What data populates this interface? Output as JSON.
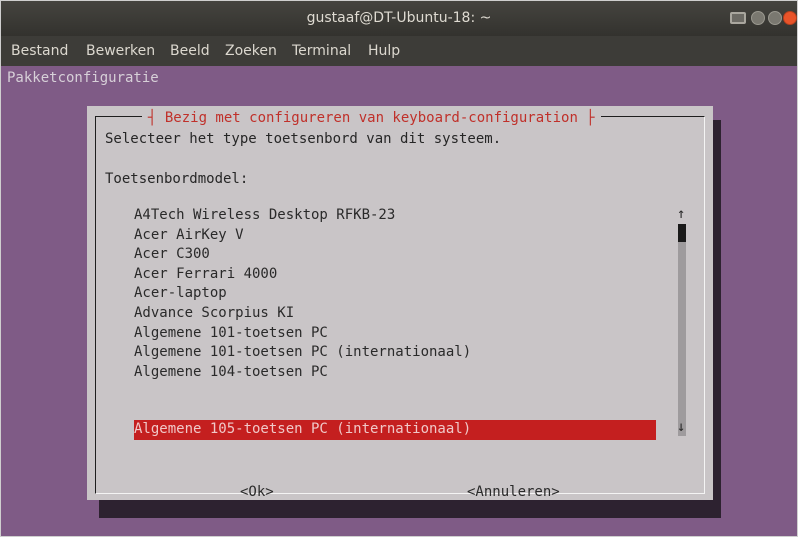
{
  "window": {
    "title": "gustaaf@DT-Ubuntu-18: ~"
  },
  "menubar": {
    "items": [
      {
        "label": "Bestand",
        "name": "menu-bestand"
      },
      {
        "label": "Bewerken",
        "name": "menu-bewerken"
      },
      {
        "label": "Beeld",
        "name": "menu-beeld"
      },
      {
        "label": "Zoeken",
        "name": "menu-zoeken"
      },
      {
        "label": "Terminal",
        "name": "menu-terminal"
      },
      {
        "label": "Hulp",
        "name": "menu-hulp"
      }
    ]
  },
  "terminal": {
    "backtitle": "Pakketconfiguratie"
  },
  "dialog": {
    "title": "Bezig met configureren van keyboard-configuration",
    "prompt": "Selecteer het type toetsenbord van dit systeem.",
    "list_label": "Toetsenbordmodel:",
    "options": [
      "A4Tech Wireless Desktop RFKB-23",
      "Acer AirKey V",
      "Acer C300",
      "Acer Ferrari 4000",
      "Acer-laptop",
      "Advance Scorpius KI",
      "Algemene 101-toetsen PC",
      "Algemene 101-toetsen PC (internationaal)",
      "Algemene 104-toetsen PC",
      "Algemene 105-toetsen PC (internationaal)"
    ],
    "selected_index": 9,
    "scroll_up": "↑",
    "scroll_down": "↓",
    "ok_label": "<Ok>",
    "cancel_label": "<Annuleren>"
  },
  "colors": {
    "terminal_bg": "#7f5b86",
    "dialog_bg": "#c9c5c7",
    "title_text": "#c0302a",
    "selection_bg": "#c41f1f",
    "selection_text": "#f0c8c8"
  }
}
